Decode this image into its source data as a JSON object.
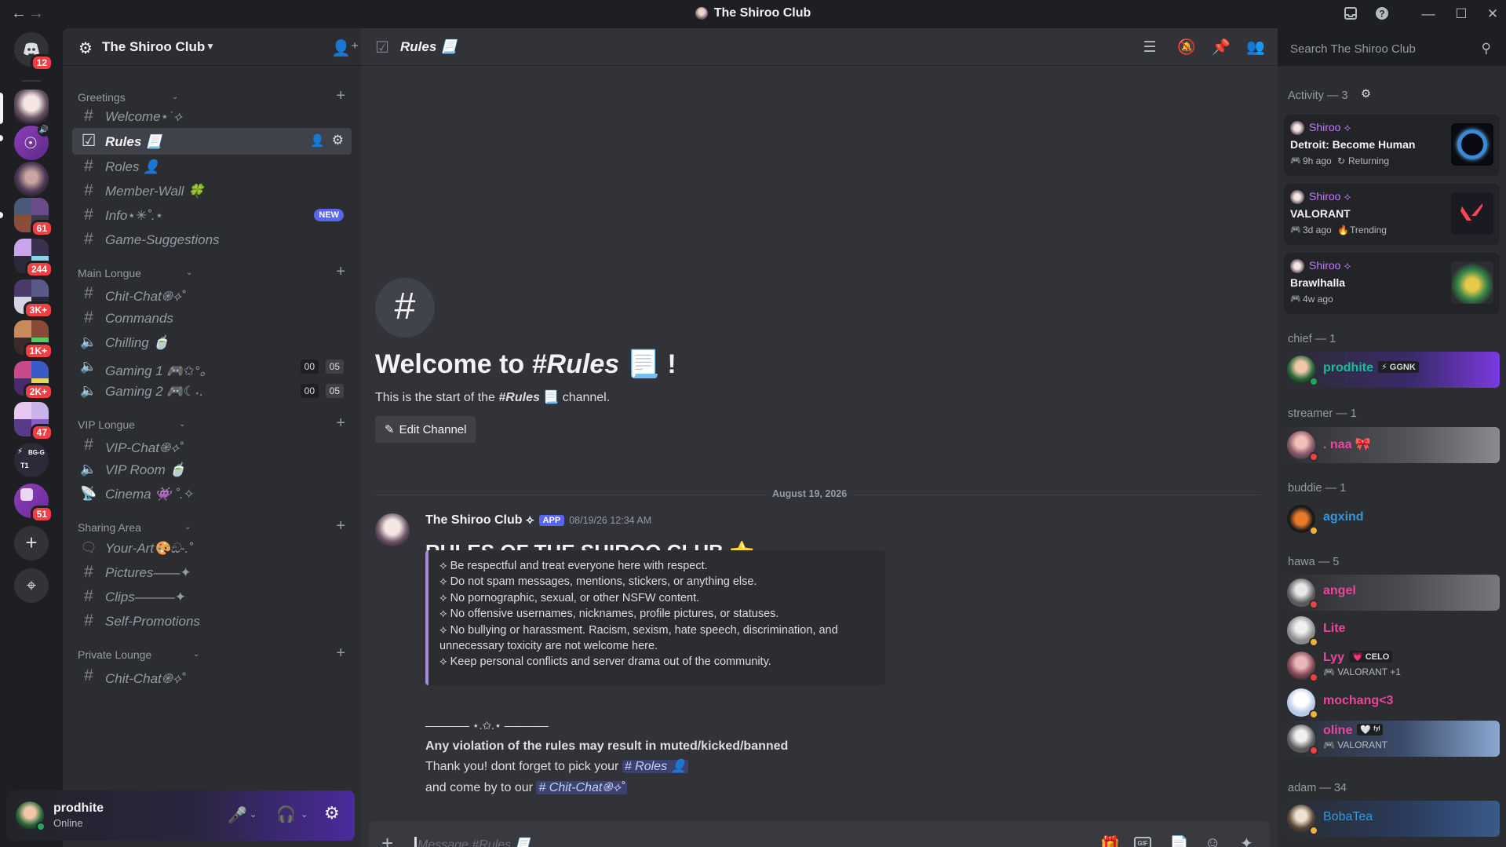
{
  "window": {
    "title": "The Shiroo Club",
    "back_icon": "←",
    "forward_icon": "→",
    "minimize": "—",
    "maximize": "☐",
    "close": "✕"
  },
  "rail": {
    "dm_badge": "12",
    "badges": [
      "61",
      "244",
      "3K+",
      "1K+",
      "2K+",
      "47",
      "51"
    ],
    "server_t1_label": "BG-G",
    "server_t1_sub": "T1",
    "add_server": "+",
    "discover": "⌖"
  },
  "server": {
    "name": "The Shiroo Club"
  },
  "categories": {
    "greetings": "Greetings",
    "main": "Main Longue",
    "vip": "VIP Longue",
    "sharing": "Sharing Area",
    "private": "Private Lounge"
  },
  "channels": {
    "welcome": "Welcome⋆˙⟡",
    "rules": "Rules 📃",
    "roles": "Roles 👤",
    "member_wall": "Member-Wall 🍀",
    "info": "Info⋆✳˚.⋆",
    "info_badge": "NEW",
    "game_suggestions": "Game-Suggestions",
    "chit_chat": "Chit-Chat֎⟡˚",
    "commands": "Commands",
    "chilling": "Chilling 🍵",
    "gaming1": "Gaming 1 🎮✩°｡",
    "gaming1_a": "00",
    "gaming1_b": "05",
    "gaming2": "Gaming 2 🎮☾˖.",
    "gaming2_a": "00",
    "gaming2_b": "05",
    "vip_chat": "VIP-Chat֎⟡˚",
    "vip_room": "VIP Room 🍵",
    "cinema": "Cinema 👾 ˚.✧",
    "your_art": "Your-Art🎨ඞ-.˚",
    "pictures": "Pictures——✦",
    "clips": "Clips———✦",
    "self_promotions": "Self-Promotions",
    "private_partial": "Chit-Chat֎⟡˚"
  },
  "user": {
    "name": "prodhite",
    "status": "Online"
  },
  "header": {
    "channel": "Rules 📃",
    "search_placeholder": "Search The Shiroo Club"
  },
  "welcome": {
    "hash": "#",
    "title_prefix": "Welcome to ",
    "title_channel": "#Rules",
    "title_suffix": " 📃 !",
    "subtitle_prefix": "This is the start of the ",
    "subtitle_channel": "#Rules",
    "subtitle_suffix": " 📃  channel.",
    "edit_button": "Edit Channel"
  },
  "divider_date": "August 19, 2026",
  "message": {
    "author": "The Shiroo Club ⟡",
    "app_tag": "APP",
    "timestamp": "08/19/26 12:34 AM",
    "heading": "RULES OF THE SHIROO CLUB ⭐",
    "rules": [
      "⟡ Be respectful and treat everyone here with respect.",
      "⟡ Do not spam messages, mentions, stickers, or anything else.",
      "⟡ No pornographic, sexual, or other NSFW content.",
      "⟡ No offensive usernames, nicknames, profile pictures, or statuses.",
      "⟡ No bullying or harassment. Racism, sexism, hate speech, discrimination, and",
      "unnecessary toxicity are not welcome here.",
      "⟡ Keep personal conflicts and server drama out of the community."
    ],
    "separator": "———— ⋆.✩.⋆ ————",
    "warning": "Any violation of the rules may result in muted/kicked/banned",
    "line1": "Thank you! dont forget to pick your ",
    "mention1": "# Roles 👤",
    "line2": "and come by to our ",
    "mention2": "# Chit-Chat֎⟡˚"
  },
  "composer": {
    "placeholder": "Message #Rules 📃",
    "plus": "+"
  },
  "activity": {
    "header": "Activity — 3",
    "items": [
      {
        "user": "Shiroo ⟡",
        "game": "Detroit: Become Human",
        "time": "9h ago",
        "extra": "Returning"
      },
      {
        "user": "Shiroo ⟡",
        "game": "VALORANT",
        "time": "3d ago",
        "extra": "Trending"
      },
      {
        "user": "Shiroo ⟡",
        "game": "Brawlhalla",
        "time": "4w ago",
        "extra": ""
      }
    ]
  },
  "member_sections": {
    "chief": "chief — 1",
    "streamer": "streamer — 1",
    "buddie": "buddie — 1",
    "hawa": "hawa — 5",
    "adam": "adam — 34"
  },
  "members": {
    "prodhite": "prodhite",
    "prodhite_tag": "⚡ GGNK",
    "naa": ". naa 🎀",
    "agxind": "agxind",
    "angel": "angel",
    "lite": "Lite",
    "lyy": "Lyy",
    "lyy_tag": "💗 CELO",
    "lyy_sub": "VALORANT +1",
    "mochang": "mochang<3",
    "oline": "oline",
    "oline_tag": "🤍 ᶠʸˡ",
    "oline_sub": "VALORANT",
    "bobatea": "BobaTea"
  },
  "colors": {
    "bg_dark": "#1e1f22",
    "sidebar": "#2b2d31",
    "main": "#313338",
    "blurple": "#5865f2",
    "online": "#23a55a",
    "dnd": "#f23f43",
    "idle": "#f0b232",
    "pink_role": "#eb459e",
    "teal_role": "#1abc9c",
    "blue_role": "#3498db"
  }
}
